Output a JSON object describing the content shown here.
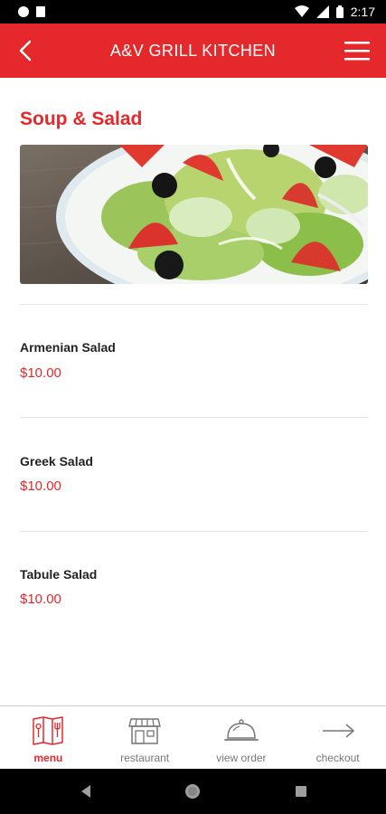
{
  "status_bar": {
    "time": "2:17"
  },
  "app_bar": {
    "title": "A&V GRILL KITCHEN"
  },
  "section": {
    "title": "Soup & Salad"
  },
  "items": [
    {
      "name": "Armenian Salad",
      "price": "$10.00"
    },
    {
      "name": "Greek Salad",
      "price": "$10.00"
    },
    {
      "name": "Tabule Salad",
      "price": "$10.00"
    }
  ],
  "bottom_nav": [
    {
      "label": "menu",
      "icon": "menu-book-icon",
      "active": true
    },
    {
      "label": "restaurant",
      "icon": "storefront-icon",
      "active": false
    },
    {
      "label": "view order",
      "icon": "cloche-icon",
      "active": false
    },
    {
      "label": "checkout",
      "icon": "arrow-right-icon",
      "active": false
    }
  ],
  "colors": {
    "brand": "#e5282b",
    "price": "#e5282b",
    "nav_inactive": "#777777"
  }
}
